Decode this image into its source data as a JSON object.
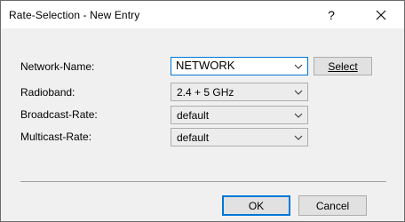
{
  "window": {
    "title": "Rate-Selection - New Entry",
    "help_label": "?",
    "close_icon": "close-icon"
  },
  "form": {
    "network_name": {
      "label": "Network-Name:",
      "value": "NETWORK",
      "button_label": "Select"
    },
    "radioband": {
      "label": "Radioband:",
      "value": "2.4 + 5 GHz"
    },
    "broadcast_rate": {
      "label": "Broadcast-Rate:",
      "value": "default"
    },
    "multicast_rate": {
      "label": "Multicast-Rate:",
      "value": "default"
    }
  },
  "buttons": {
    "ok_label": "OK",
    "cancel_label": "Cancel"
  },
  "colors": {
    "focus_accent": "#0078d7",
    "dialog_bg": "#f0f0f0",
    "button_bg": "#e1e1e1"
  }
}
